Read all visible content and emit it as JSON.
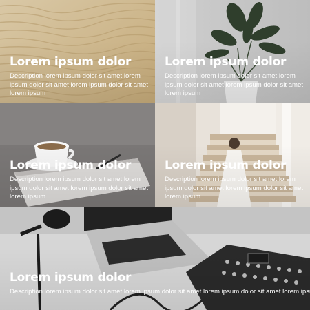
{
  "gallery": {
    "tiles": [
      {
        "title": "Lorem ipsum dolor",
        "description": "Description lorem ipsum dolor sit amet lorem ipsum dolor sit amet lorem ipsum dolor sit amet lorem ipsum",
        "scene": "sand-dunes"
      },
      {
        "title": "Lorem ipsum dolor",
        "description": "Description lorem ipsum dolor sit amet lorem ipsum dolor sit amet lorem ipsum dolor sit amet lorem ipsum",
        "scene": "potted-plant"
      },
      {
        "title": "Lorem ipsum dolor",
        "description": "Description lorem ipsum dolor sit amet lorem ipsum dolor sit amet lorem ipsum dolor sit amet lorem ipsum",
        "scene": "coffee-notebook"
      },
      {
        "title": "Lorem ipsum dolor",
        "description": "Description lorem ipsum dolor sit amet lorem ipsum dolor sit amet lorem ipsum dolor sit amet lorem ipsum",
        "scene": "woman-stairs"
      },
      {
        "title": "Lorem ipsum dolor",
        "description": "Description lorem ipsum dolor sit amet lorem ipsum dolor sit amet lorem ipsum dolor sit amet lorem ipsum dolor sit amet lorem ipsum",
        "scene": "laptop-microphone-mixer"
      }
    ]
  },
  "colors": {
    "caption_text": "#ffffff",
    "sand": "#cbb48c",
    "studio_gray": "#bdbdbd"
  }
}
